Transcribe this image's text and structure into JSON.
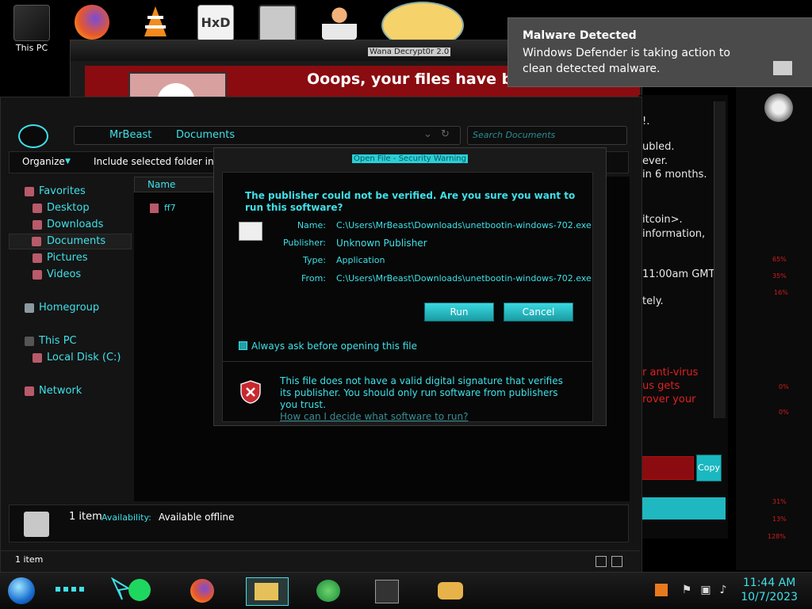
{
  "desktop": {
    "icons": [
      {
        "label": "This PC",
        "icon": "this-pc-icon"
      },
      {
        "label": "",
        "icon": "firefox-icon"
      },
      {
        "label": "",
        "icon": "vlc-icon"
      },
      {
        "label": "",
        "icon": "hxd-icon"
      },
      {
        "label": "",
        "icon": "app-icon"
      },
      {
        "label": "",
        "icon": "user-icon"
      },
      {
        "label": "",
        "icon": "character-icon"
      }
    ]
  },
  "ransom_window": {
    "title": "Wana Decrypt0r 2.0",
    "headline": "Ooops, your files have bee"
  },
  "ransom_panel": {
    "lines": [
      "!.",
      "ubled.",
      "ever.",
      "in 6 months.",
      "itcoin>.",
      "information,",
      "11:00am GMT",
      "tely.",
      "r anti-virus",
      "us gets",
      "rover your"
    ],
    "copy_label": "Copy"
  },
  "alienware_panel": {
    "percents": [
      "65%",
      "35%",
      "16%",
      "0%",
      "0%",
      "31%",
      "13%",
      "128%"
    ]
  },
  "explorer": {
    "breadcrumb": [
      "MrBeast",
      "Documents"
    ],
    "search_placeholder": "Search Documents",
    "toolbar": {
      "organize": "Organize",
      "include": "Include selected folder in li"
    },
    "nav": {
      "favorites": "Favorites",
      "desktop": "Desktop",
      "downloads": "Downloads",
      "documents": "Documents",
      "pictures": "Pictures",
      "videos": "Videos",
      "homegroup": "Homegroup",
      "this_pc": "This PC",
      "local_disk": "Local Disk (C:)",
      "network": "Network"
    },
    "column_name": "Name",
    "files": [
      {
        "name": "ff7"
      }
    ],
    "details": {
      "count": "1 item",
      "availability_label": "Availability:",
      "availability_value": "Available offline"
    },
    "status": "1 item"
  },
  "dialog": {
    "title": "Open File - Security Warning",
    "question": "The publisher could not be verified.  Are you sure you want to run this software?",
    "fields": {
      "name_label": "Name:",
      "name_value": "C:\\Users\\MrBeast\\Downloads\\unetbootin-windows-702.exe",
      "publisher_label": "Publisher:",
      "publisher_value": "Unknown Publisher",
      "type_label": "Type:",
      "type_value": "Application",
      "from_label": "From:",
      "from_value": "C:\\Users\\MrBeast\\Downloads\\unetbootin-windows-702.exe"
    },
    "run": "Run",
    "cancel": "Cancel",
    "checkbox": "Always ask before opening this file",
    "checkbox_checked": true,
    "warning": "This file does not have a valid digital signature that verifies its publisher.  You should only run software from publishers you trust.",
    "link": "How can I decide what software to run?"
  },
  "notification": {
    "title": "Malware Detected",
    "body": "Windows Defender is taking action to clean detected malware."
  },
  "taskbar": {
    "time": "11:44 AM",
    "date": "10/7/2023",
    "apps": [
      "spotify-icon",
      "firefox-icon",
      "file-explorer-icon",
      "download-manager-icon",
      "security-icon",
      "handshake-icon"
    ]
  },
  "colors": {
    "accent": "#3fe0e8",
    "alert_red": "#d21c1c",
    "ransom_red": "#8a0c10"
  }
}
